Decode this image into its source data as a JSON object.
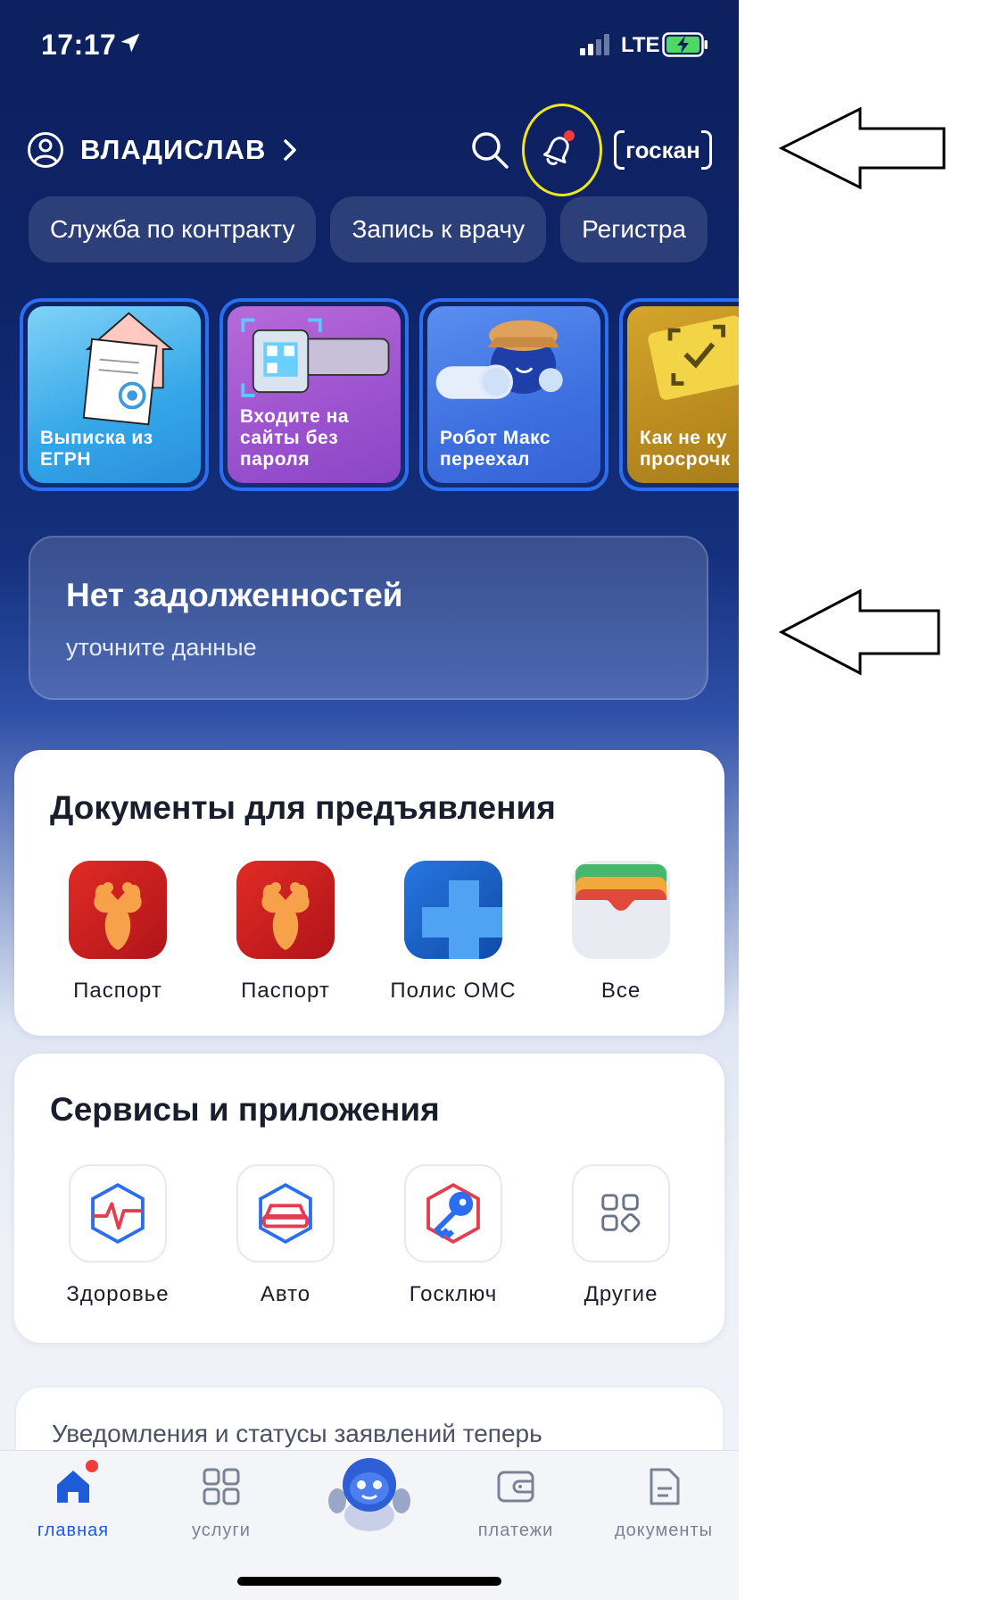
{
  "status_bar": {
    "time": "17:17",
    "network": "LTE"
  },
  "header": {
    "user_name": "ВЛАДИСЛАВ",
    "scan_label": "госкан"
  },
  "chips": [
    "Служба по контракту",
    "Запись к врачу",
    "Регистра"
  ],
  "stories": [
    {
      "title": "Выписка из\nЕГРН"
    },
    {
      "title": "Входите на\nсайты без\nпароля"
    },
    {
      "title": "Робот Макс\nпереехал"
    },
    {
      "title": "Как не ку\nпросрочк"
    }
  ],
  "debt": {
    "title": "Нет задолженностей",
    "subtitle": "уточните данные"
  },
  "documents": {
    "title": "Документы для предъявления",
    "items": [
      {
        "label": "Паспорт",
        "icon": "passport-emblem-icon"
      },
      {
        "label": "Паспорт",
        "icon": "passport-emblem-icon"
      },
      {
        "label": "Полис ОМС",
        "icon": "medical-cross-icon"
      },
      {
        "label": "Все",
        "icon": "wallet-cards-icon"
      }
    ]
  },
  "services": {
    "title": "Сервисы и приложения",
    "items": [
      {
        "label": "Здоровье",
        "icon": "health-pulse-icon"
      },
      {
        "label": "Авто",
        "icon": "car-icon"
      },
      {
        "label": "Госключ",
        "icon": "key-icon"
      },
      {
        "label": "Другие",
        "icon": "grid-apps-icon"
      }
    ]
  },
  "notice": {
    "text": "Уведомления и статусы заявлений теперь"
  },
  "bottom_nav": [
    {
      "label": "главная",
      "icon": "home-icon",
      "active": true
    },
    {
      "label": "услуги",
      "icon": "grid-icon",
      "active": false
    },
    {
      "label": "",
      "icon": "robot-assistant-icon",
      "active": false
    },
    {
      "label": "платежи",
      "icon": "wallet-icon",
      "active": false
    },
    {
      "label": "документы",
      "icon": "document-icon",
      "active": false
    }
  ],
  "colors": {
    "primary_dark": "#0d1f5e",
    "accent_blue": "#1d5bd8",
    "highlight_yellow": "#f0e61a",
    "notification_red": "#f23b3b"
  }
}
